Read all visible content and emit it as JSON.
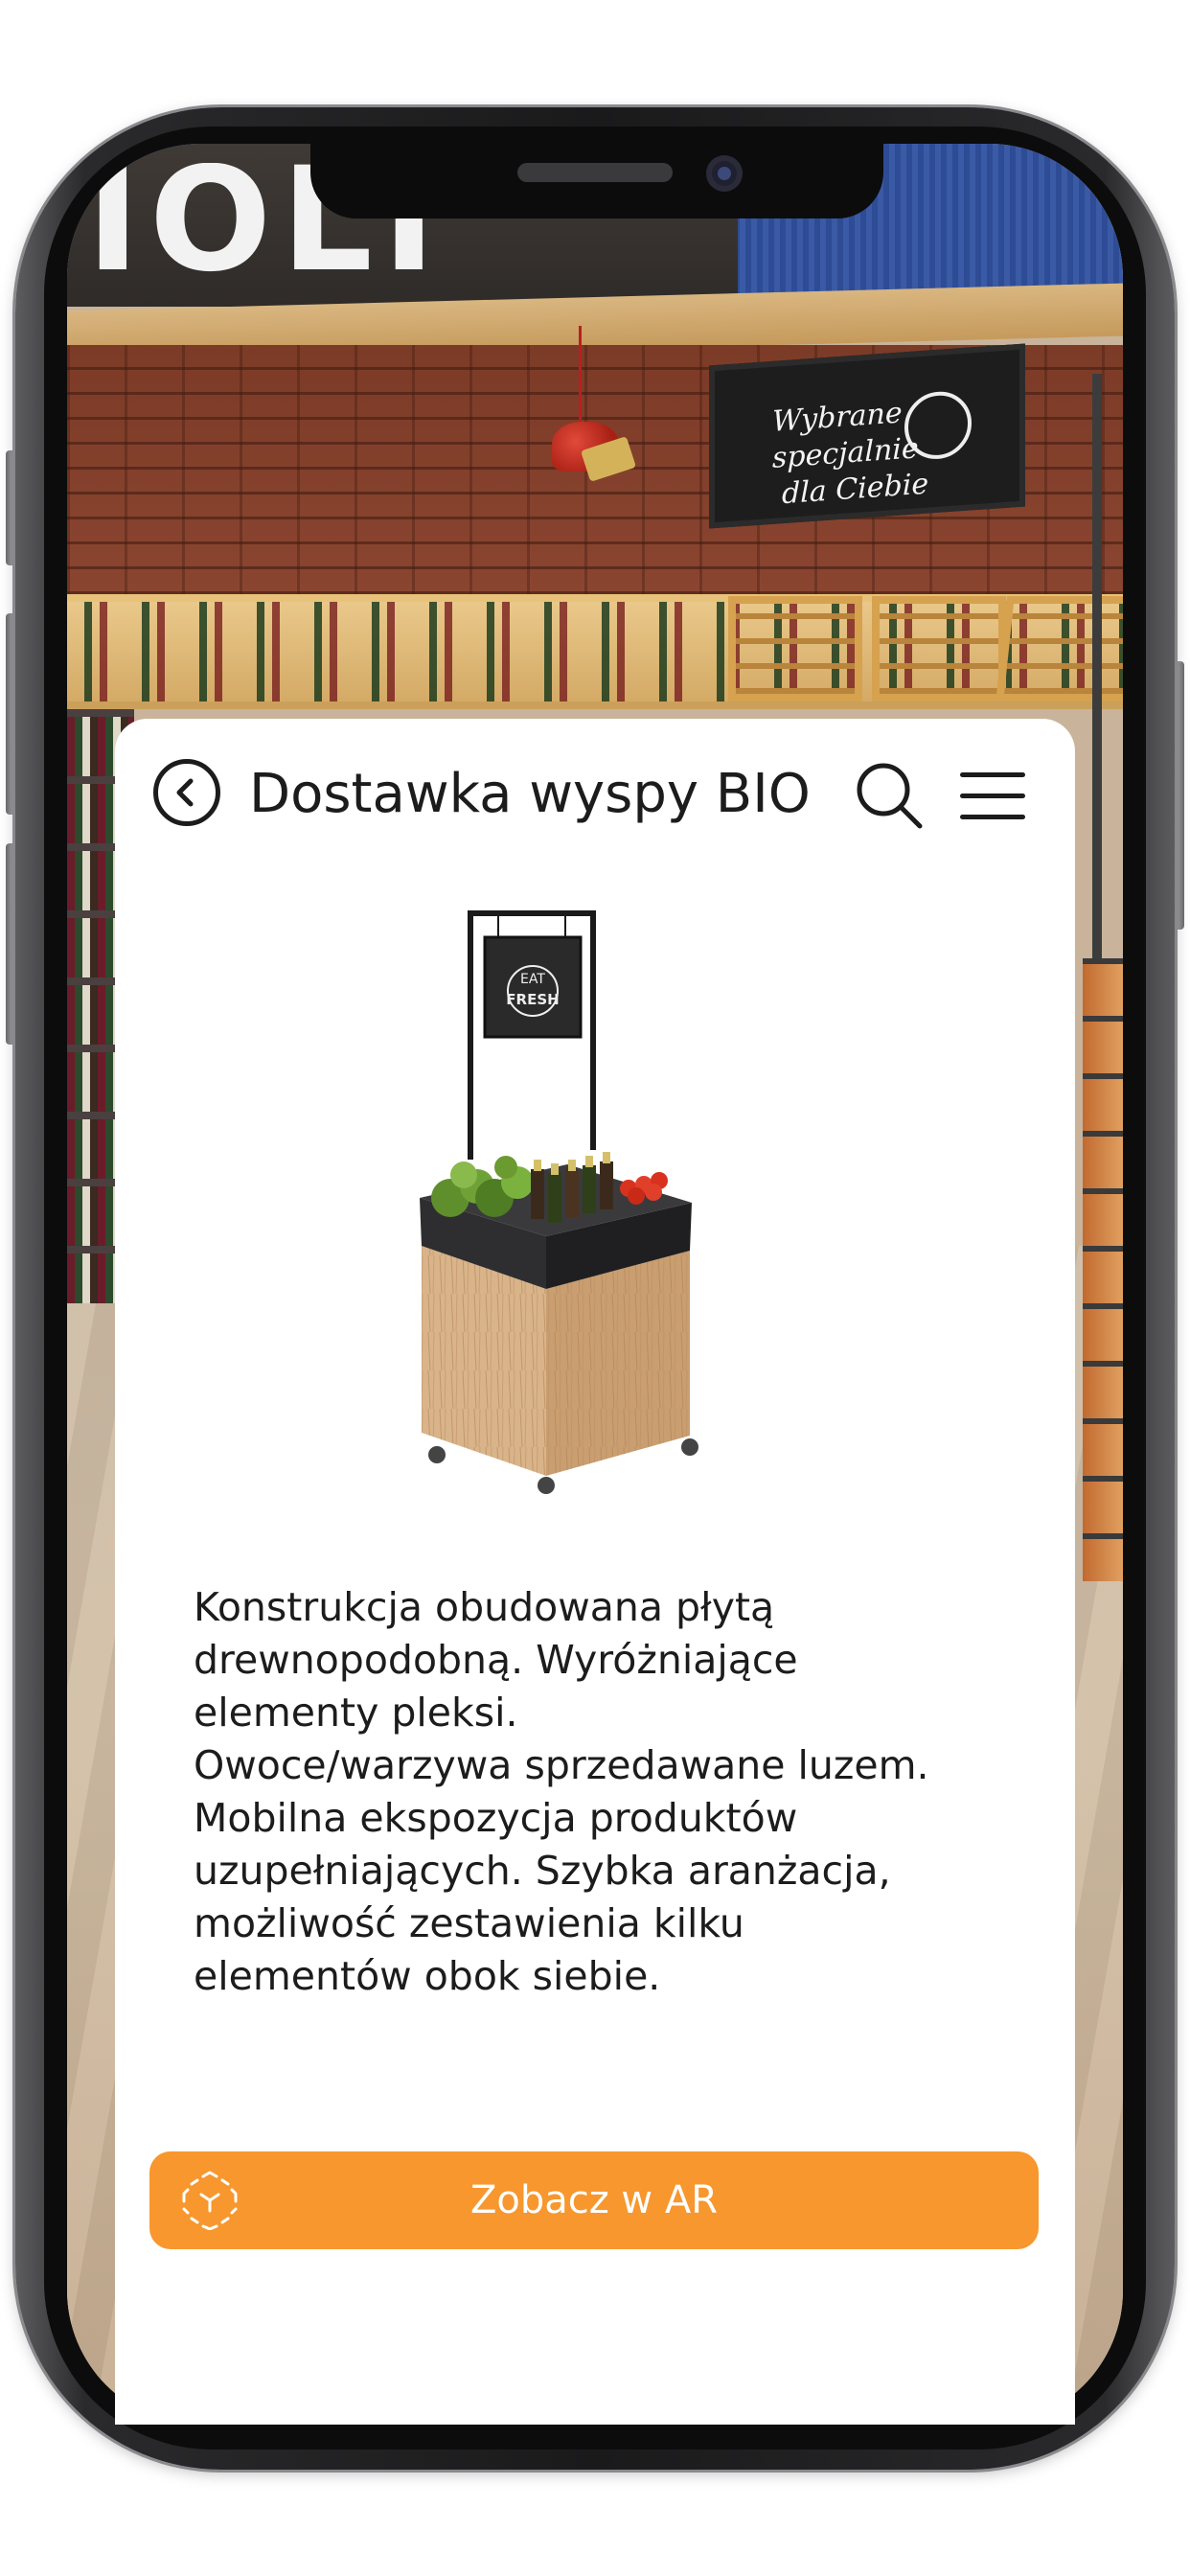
{
  "store_background": {
    "store_sign_letters": "IOLI",
    "chalkboard_sign": [
      "Wybrane",
      "specjalnie",
      "dla Ciebie"
    ]
  },
  "product": {
    "title": "Dostawka wyspy BIO",
    "image_sign_text": [
      "EAT",
      "FRESH"
    ],
    "description": "Konstrukcja obudowana płytą\ndrewnopodobną. Wyróżniające\nelementy pleksi.\nOwoce/warzywa sprzedawane luzem.\nMobilna ekspozycja produktów\nuzupełniających. Szybka aranżacja,\nmożliwość zestawienia kilku\nelementów obok siebie.",
    "ar_button_label": "Zobacz w AR"
  },
  "header": {
    "icons": [
      "chevron-left-circle-icon",
      "search-icon",
      "hamburger-menu-icon"
    ]
  },
  "colors": {
    "accent": "#f7972e",
    "card_background": "#ffffff",
    "text": "#1c1c1c"
  }
}
